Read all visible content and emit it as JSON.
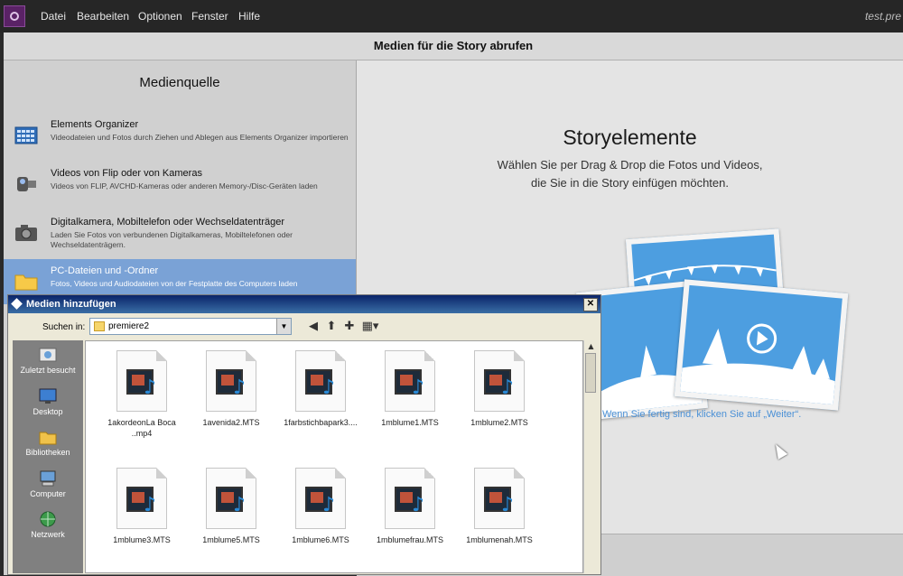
{
  "menubar": {
    "items": [
      "Datei",
      "Bearbeiten",
      "Optionen",
      "Fenster",
      "Hilfe"
    ],
    "doc_title": "test.pre"
  },
  "panel": {
    "header": "Medien für die Story abrufen",
    "source_title": "Medienquelle",
    "sources": [
      {
        "title": "Elements Organizer",
        "desc": "Videodateien und Fotos durch Ziehen und Ablegen aus Elements Organizer importieren"
      },
      {
        "title": "Videos von Flip oder von Kameras",
        "desc": "Videos von FLIP, AVCHD-Kameras oder anderen Memory-/Disc-Geräten laden"
      },
      {
        "title": "Digitalkamera, Mobiltelefon oder Wechseldatenträger",
        "desc": "Laden Sie Fotos von verbundenen Digitalkameras, Mobiltelefonen oder Wechseldatenträgern."
      },
      {
        "title": "PC-Dateien und -Ordner",
        "desc": "Fotos, Videos und Audiodateien von der Festplatte des Computers laden"
      }
    ],
    "story_title": "Storyelemente",
    "story_sub_1": "Wählen Sie per Drag & Drop die Fotos und Videos,",
    "story_sub_2": "die Sie in die Story einfügen möchten.",
    "story_hint": "Wenn Sie fertig sind, klicken Sie auf „Weiter“."
  },
  "dialog": {
    "title": "Medien hinzufügen",
    "close": "✕",
    "look_in_label": "Suchen in:",
    "look_in_value": "premiere2",
    "places": [
      "Zuletzt besucht",
      "Desktop",
      "Bibliotheken",
      "Computer",
      "Netzwerk"
    ],
    "files": [
      "1akordeonLa Boca ..mp4",
      "1avenida2.MTS",
      "1farbstichbapark3....",
      "1mblume1.MTS",
      "1mblume2.MTS",
      "1mblume3.MTS",
      "1mblume5.MTS",
      "1mblume6.MTS",
      "1mblumefrau.MTS",
      "1mblumenah.MTS"
    ]
  },
  "colors": {
    "selected_source": "#7aa2d6",
    "hint_link": "#4a90d6",
    "photo_blue": "#4d9ee0"
  }
}
